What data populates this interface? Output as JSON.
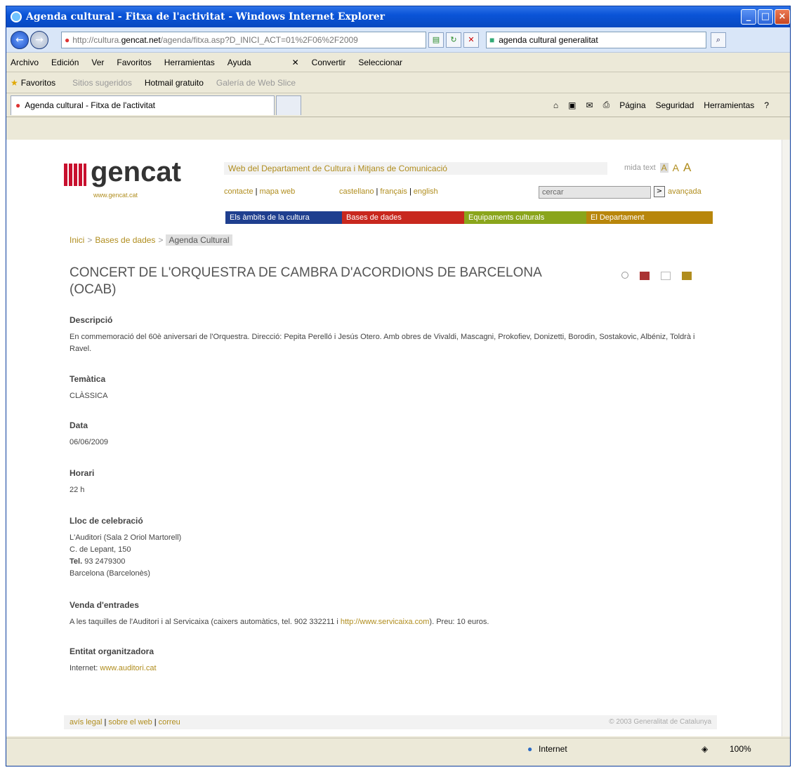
{
  "window": {
    "title": "Agenda cultural - Fitxa de l'activitat - Windows Internet Explorer"
  },
  "toolbar": {
    "address_prefix": "http://cultura.",
    "address_domain": "gencat.net",
    "address_rest": "/agenda/fitxa.asp?D_INICI_ACT=01%2F06%2F2009",
    "search_value": "agenda cultural generalitat"
  },
  "menu": [
    "Archivo",
    "Edición",
    "Ver",
    "Favoritos",
    "Herramientas",
    "Ayuda"
  ],
  "menu_extra": {
    "convertir": "Convertir",
    "seleccionar": "Seleccionar"
  },
  "favorites": {
    "label": "Favoritos",
    "sugeridos": "Sitios sugeridos",
    "hotmail": "Hotmail gratuito",
    "galeria": "Galería de Web Slice"
  },
  "tab": {
    "label": "Agenda cultural - Fitxa de l'activitat"
  },
  "commands": [
    "Página",
    "Seguridad",
    "Herramientas"
  ],
  "site": {
    "logo_word": "gencat",
    "logo_url": "www.gencat.cat",
    "header": "Web del Departament de Cultura i Mitjans de Comunicació",
    "mida_text": "mida text",
    "links_left": [
      "contacte",
      "mapa web"
    ],
    "links_lang": [
      "castellano",
      "français",
      "english"
    ],
    "search_placeholder": "cercar",
    "avancada": "avançada",
    "sections": [
      {
        "label": "Els àmbits de la cultura",
        "color": "#1f3f8f"
      },
      {
        "label": "Bases de dades",
        "color": "#c8281e"
      },
      {
        "label": "Equipaments culturals",
        "color": "#8aa51b"
      },
      {
        "label": "El Departament",
        "color": "#b8860b"
      }
    ],
    "breadcrumb": [
      "Inici",
      "Bases de dades",
      "Agenda Cultural"
    ]
  },
  "event": {
    "title": "CONCERT DE L'ORQUESTRA DE CAMBRA D'ACORDIONS DE BARCELONA (OCAB)",
    "descripcio_h": "Descripció",
    "descripcio": "En commemoració del 60è aniversari de l'Orquestra. Direcció: Pepita Perelló i Jesús Otero. Amb obres de Vivaldi, Mascagni, Prokofiev, Donizetti, Borodin, Sostakovic, Albéniz, Toldrà i Ravel.",
    "tematica_h": "Temàtica",
    "tematica": "CLÀSSICA",
    "data_h": "Data",
    "data": "06/06/2009",
    "horari_h": "Horari",
    "horari": "22 h",
    "lloc_h": "Lloc de celebració",
    "lloc_1": "L'Auditori (Sala 2 Oriol Martorell)",
    "lloc_2": "C. de Lepant, 150",
    "lloc_tel_label": "Tel.",
    "lloc_tel": "93 2479300",
    "lloc_3": "Barcelona (Barcelonès)",
    "venda_h": "Venda d'entrades",
    "venda_pre": "A les taquilles de l'Auditori i al Servicaixa (caixers automàtics, tel. 902 332211 i ",
    "venda_link": "http://www.servicaixa.com",
    "venda_post": "). Preu: 10 euros.",
    "entitat_h": "Entitat organitzadora",
    "entitat_pre": "Internet: ",
    "entitat_link": "www.auditori.cat"
  },
  "footer": {
    "links": [
      "avís legal",
      "sobre el web",
      "correu"
    ],
    "copyright": "© 2003 Generalitat de Catalunya"
  },
  "status": {
    "zone": "Internet",
    "zoom": "100%"
  }
}
